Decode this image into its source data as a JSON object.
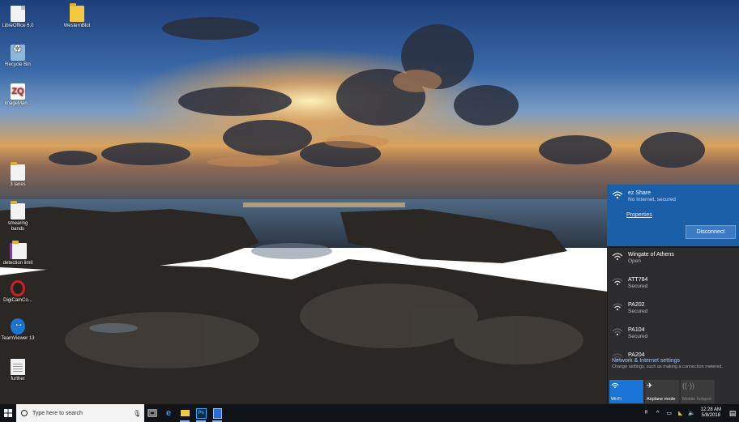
{
  "desktop": {
    "icons": [
      {
        "label": "LibreOffice 6.0",
        "icon": "libreoffice-doc-icon"
      },
      {
        "label": "WesternBlot",
        "icon": "folder-icon"
      },
      {
        "label": "Recycle Bin",
        "icon": "recycle-bin-icon"
      },
      {
        "label": "ImageMan...",
        "icon": "imagemanager-app-icon"
      },
      {
        "label": "3 lanes",
        "icon": "folder-icon"
      },
      {
        "label": "smearing bands",
        "icon": "folder-icon"
      },
      {
        "label": "detection limit",
        "icon": "notebook-icon"
      },
      {
        "label": "DigiCamCo...",
        "icon": "digicamcontrol-icon"
      },
      {
        "label": "TeamViewer 13",
        "icon": "teamviewer-icon"
      },
      {
        "label": "further",
        "icon": "text-file-icon"
      }
    ]
  },
  "network": {
    "connected": {
      "name": "ez Share",
      "status": "No Internet, secured",
      "properties_label": "Properties",
      "disconnect_label": "Disconnect"
    },
    "networks": [
      {
        "name": "Wingate of Athens",
        "status": "Open"
      },
      {
        "name": "ATT784",
        "status": "Secured"
      },
      {
        "name": "PA202",
        "status": "Secured"
      },
      {
        "name": "PA104",
        "status": "Secured"
      },
      {
        "name": "PA204",
        "status": ""
      }
    ],
    "settings_link": "Network & Internet settings",
    "settings_desc": "Change settings, such as making a connection metered.",
    "quick_actions": [
      {
        "label": "Wi-Fi",
        "icon": "wifi-icon",
        "state": "on"
      },
      {
        "label": "Airplane mode",
        "icon": "airplane-icon",
        "state": "off"
      },
      {
        "label": "Mobile hotspot",
        "icon": "hotspot-icon",
        "state": "disabled"
      }
    ]
  },
  "taskbar": {
    "search_placeholder": "Type here to search",
    "clock_time": "12:28 AM",
    "clock_date": "5/8/2018"
  },
  "colors": {
    "accent": "#1b5fa8",
    "taskbar": "#101418",
    "flyout": "#1c1c1e"
  }
}
